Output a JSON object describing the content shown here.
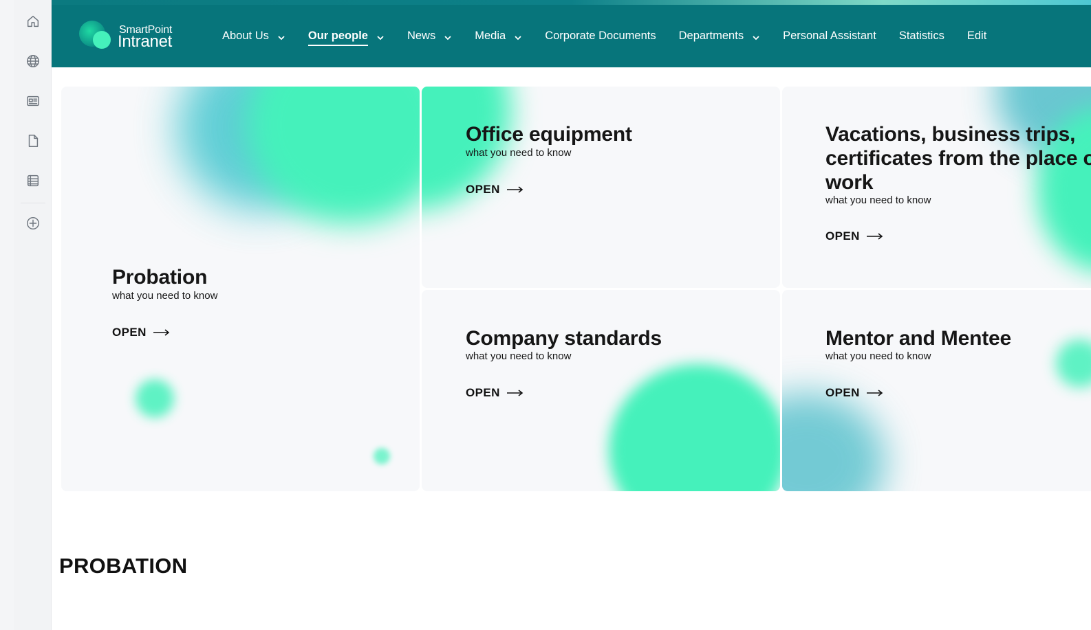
{
  "brand": {
    "name_top": "SmartPoint",
    "name_bottom": "Intranet",
    "colors": {
      "primary": "#07757b",
      "accent": "#45f1bb",
      "accent_teal": "#3bb7c4",
      "card_bg": "#f7f8fa"
    }
  },
  "rail": {
    "items": [
      {
        "icon": "home-icon"
      },
      {
        "icon": "globe-icon"
      },
      {
        "icon": "news-icon"
      },
      {
        "icon": "document-icon"
      },
      {
        "icon": "table-icon"
      },
      {
        "icon": "add-circle-icon"
      }
    ]
  },
  "nav": {
    "items": [
      {
        "label": "About Us",
        "dropdown": true,
        "active": false
      },
      {
        "label": "Our people",
        "dropdown": true,
        "active": true
      },
      {
        "label": "News",
        "dropdown": true,
        "active": false
      },
      {
        "label": "Media",
        "dropdown": true,
        "active": false
      },
      {
        "label": "Corporate Documents",
        "dropdown": false,
        "active": false
      },
      {
        "label": "Departments",
        "dropdown": true,
        "active": false
      },
      {
        "label": "Personal Assistant",
        "dropdown": false,
        "active": false
      },
      {
        "label": "Statistics",
        "dropdown": false,
        "active": false
      },
      {
        "label": "Edit",
        "dropdown": false,
        "active": false
      }
    ]
  },
  "cards": {
    "probation": {
      "title": "Probation",
      "subtitle": "what you need to know",
      "action": "OPEN"
    },
    "office_equipment": {
      "title": "Office equipment",
      "subtitle": "what you need to know",
      "action": "OPEN"
    },
    "vacations": {
      "title": "Vacations, business trips, certificates from the place of work",
      "subtitle": "what you need to know",
      "action": "OPEN"
    },
    "company_standards": {
      "title": "Company standards",
      "subtitle": "what you need to know",
      "action": "OPEN"
    },
    "mentor": {
      "title": "Mentor and Mentee",
      "subtitle": "what you need to know",
      "action": "OPEN"
    }
  },
  "section": {
    "heading": "PROBATION"
  }
}
